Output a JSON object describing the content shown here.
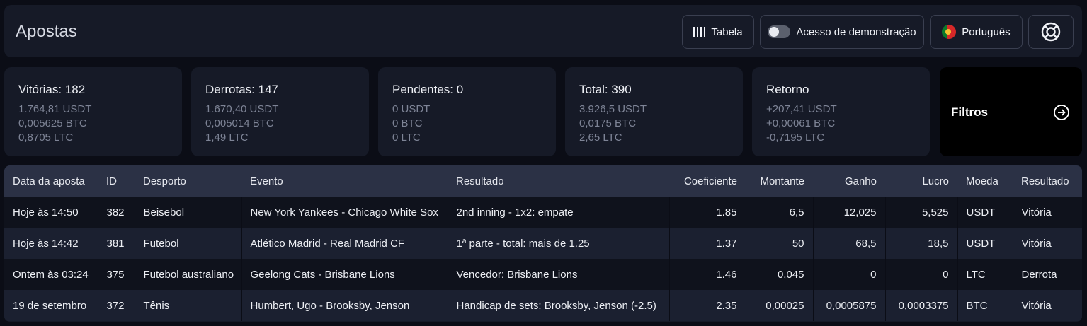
{
  "header": {
    "title": "Apostas",
    "table_label": "Tabela",
    "demo_label": "Acesso de demonstração",
    "language_label": "Português"
  },
  "cards": [
    {
      "title": "Vitórias: 182",
      "lines": [
        "1.764,81 USDT",
        "0,005625 BTC",
        "0,8705 LTC"
      ]
    },
    {
      "title": "Derrotas: 147",
      "lines": [
        "1.670,40 USDT",
        "0,005014 BTC",
        "1,49 LTC"
      ]
    },
    {
      "title": "Pendentes: 0",
      "lines": [
        "0 USDT",
        "0 BTC",
        "0 LTC"
      ]
    },
    {
      "title": "Total: 390",
      "lines": [
        "3.926,5 USDT",
        "0,0175 BTC",
        "2,65 LTC"
      ]
    },
    {
      "title": "Retorno",
      "lines": [
        "+207,41 USDT",
        "+0,00061 BTC",
        "-0,7195 LTC"
      ]
    }
  ],
  "filters": {
    "label": "Filtros"
  },
  "table": {
    "columns": [
      "Data da aposta",
      "ID",
      "Desporto",
      "Evento",
      "Resultado",
      "Coeficiente",
      "Montante",
      "Ganho",
      "Lucro",
      "Moeda",
      "Resultado"
    ],
    "rows": [
      [
        "Hoje às 14:50",
        "382",
        "Beisebol",
        "New York Yankees - Chicago White Sox",
        "2nd inning - 1x2: empate",
        "1.85",
        "6,5",
        "12,025",
        "5,525",
        "USDT",
        "Vitória"
      ],
      [
        "Hoje às 14:42",
        "381",
        "Futebol",
        "Atlético Madrid - Real Madrid CF",
        "1ª parte - total: mais de 1.25",
        "1.37",
        "50",
        "68,5",
        "18,5",
        "USDT",
        "Vitória"
      ],
      [
        "Ontem às 03:24",
        "375",
        "Futebol australiano",
        "Geelong Cats - Brisbane Lions",
        "Vencedor: Brisbane Lions",
        "1.46",
        "0,045",
        "0",
        "0",
        "LTC",
        "Derrota"
      ],
      [
        "19 de setembro",
        "372",
        "Tênis",
        "Humbert, Ugo - Brooksby, Jenson",
        "Handicap de sets: Brooksby, Jenson (-2.5)",
        "2.35",
        "0,00025",
        "0,0005875",
        "0,0003375",
        "BTC",
        "Vitória"
      ]
    ]
  },
  "icons": [
    "columns-icon",
    "toggle-icon",
    "portugal-flag-icon",
    "lifebuoy-icon",
    "arrow-right-circle-icon"
  ],
  "colors": {
    "background": "#0b0d16",
    "panel": "#161a27",
    "table_header": "#2b3145"
  }
}
